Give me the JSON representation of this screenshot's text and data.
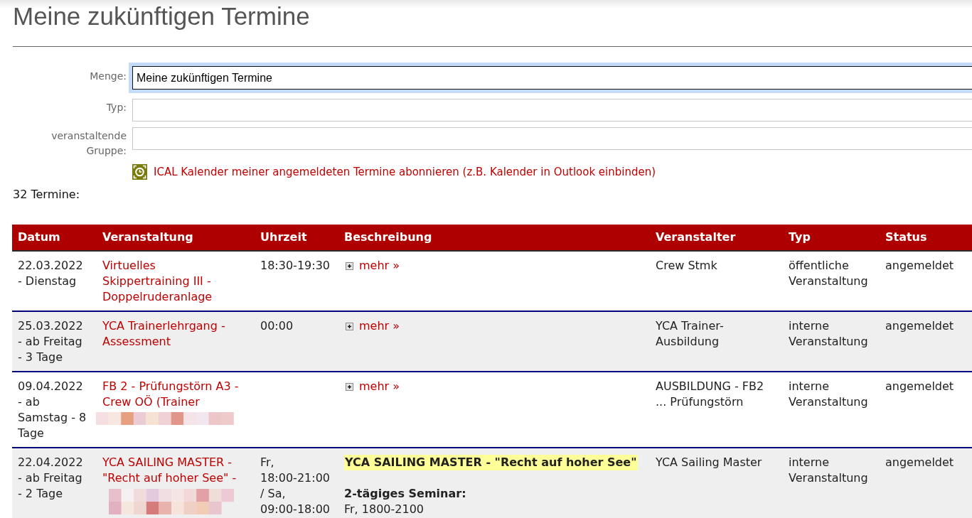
{
  "page": {
    "title": "Meine zukünftigen Termine"
  },
  "filters": [
    {
      "label": "Menge:",
      "value": "Meine zukünftigen Termine",
      "focused": true
    },
    {
      "label": "Typ:",
      "focused": false
    },
    {
      "label": "veranstaltende Gruppe:",
      "focused": false
    }
  ],
  "ical_link": {
    "text": "ICAL Kalender meiner angemeldeten Termine abonnieren (z.B. Kalender in Outlook einbinden)"
  },
  "count": "32 Termine:",
  "table": {
    "columns": [
      "Datum",
      "Veranstaltung",
      "Uhrzeit",
      "Beschreibung",
      "Veranstalter",
      "Typ",
      "Status"
    ],
    "rows": [
      {
        "date": "22.03.2022 - Dienstag",
        "event": "Virtuelles Skippertraining III - Doppelruderanlage",
        "time": "18:30-19:30",
        "description": [
          {
            "kind": "more",
            "text": "mehr »"
          }
        ],
        "organizer": "Crew Stmk",
        "type": "öffentliche Veranstaltung",
        "status": "angemeldet"
      },
      {
        "date": "25.03.2022 - ab Freitag - 3 Tage",
        "event": "YCA Trainerlehrgang - Assessment",
        "time": "00:00",
        "description": [
          {
            "kind": "more",
            "text": "mehr »"
          }
        ],
        "organizer": "YCA Trainer-Ausbildung",
        "type": "interne Veranstaltung",
        "status": "angemeldet"
      },
      {
        "date": "09.04.2022 - ab Samstag - 8 Tage",
        "event": "FB 2 - Prüfungstörn A3 - Crew OÖ (Trainer",
        "redaction": {
          "kind": "short"
        },
        "description": [
          {
            "kind": "more",
            "text": "mehr »"
          }
        ],
        "organizer": "AUSBILDUNG - FB2 ... Prüfungstörn",
        "type": "interne Veranstaltung",
        "status": "angemeldet"
      },
      {
        "date": "22.04.2022 - ab Freitag - 2 Tage",
        "event": "YCA SAILING MASTER - \"Recht auf hoher See\" -",
        "redaction": {
          "kind": "long"
        },
        "time": "Fr, 18:00-21:00 / Sa, 09:00-18:00",
        "description": [
          {
            "kind": "highlight",
            "text": "YCA SAILING MASTER - \"Recht auf hoher See\""
          },
          {
            "kind": "heading",
            "text": "2-tägiges Seminar:"
          },
          {
            "kind": "text",
            "text": "Fr, 1800-2100"
          }
        ],
        "organizer": "YCA Sailing Master",
        "type": "interne Veranstaltung",
        "status": "angemeldet"
      }
    ]
  }
}
